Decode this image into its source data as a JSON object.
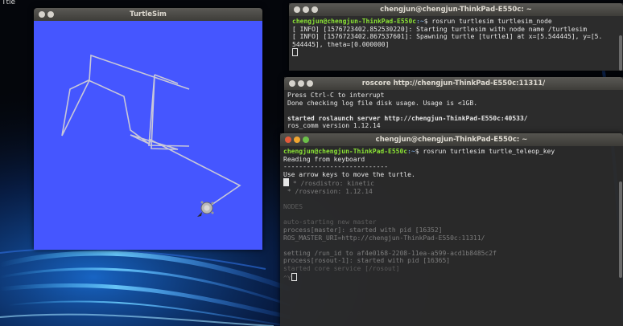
{
  "desktop": {
    "label": "Ttle"
  },
  "turtlesim": {
    "title": "TurtleSim",
    "colors": {
      "background": "#4556ff",
      "path": "#c8c8d8"
    }
  },
  "terminal1": {
    "title": "chengjun@chengjun-ThinkPad-E550c: ~",
    "user": "chengjun@chengjun-ThinkPad-E550c",
    "path": ":~",
    "command": "$ rosrun turtlesim turtlesim_node",
    "lines": [
      "[ INFO] [1576723402.852530220]: Starting turtlesim with node name /turtlesim",
      "[ INFO] [1576723402.867537601]: Spawning turtle [turtle1] at x=[5.544445], y=[5.",
      "544445], theta=[0.000000]"
    ]
  },
  "terminal2": {
    "title": "roscore http://chengjun-ThinkPad-E550c:11311/",
    "lines": [
      "Press Ctrl-C to interrupt",
      "Done checking log file disk usage. Usage is <1GB."
    ],
    "server_line": "started roslaunch server http://chengjun-ThinkPad-E550c:40533/",
    "version_line": "ros_comm version 1.12.14"
  },
  "terminal3": {
    "title": "chengjun@chengjun-ThinkPad-E550c: ~",
    "user": "chengjun@chengjun-ThinkPad-E550c",
    "path": ":~",
    "command": "$ rosrun turtlesim turtle_teleop_key",
    "lines": [
      "Reading from keyboard",
      "---------------------------",
      "Use arrow keys to move the turtle."
    ],
    "ghost_lines": [
      " * /rosdistro: kinetic",
      " * /rosversion: 1.12.14",
      "",
      "NODES",
      "",
      "auto-starting new master",
      "process[master]: started with pid [16352]",
      "ROS_MASTER_URI=http://chengjun-ThinkPad-E550c:11311/",
      "",
      "setting /run_id to af4e0168-2208-11ea-a599-acd1b8485c2f",
      "process[rosout-1]: started with pid [16365]",
      "started core service [/rosout]",
      "^Y"
    ]
  }
}
